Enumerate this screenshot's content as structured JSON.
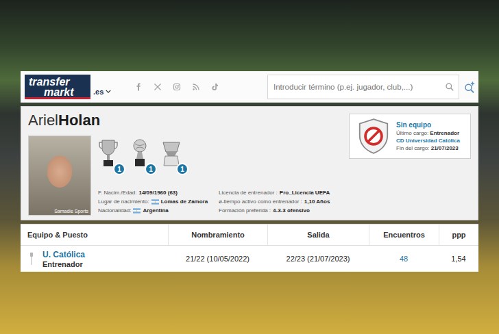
{
  "header": {
    "logo_line1": "transfer",
    "logo_line2": "markt",
    "domain": ".es",
    "search_placeholder": "Introducir término (p.ej. jugador, club,...)"
  },
  "profile": {
    "first_name": "Ariel",
    "last_name": "Holan",
    "photo_credit": "Samadie Sports",
    "trophies": [
      {
        "kind": "cup",
        "count": "1"
      },
      {
        "kind": "ball",
        "count": "1"
      },
      {
        "kind": "bowl",
        "count": "1"
      }
    ],
    "facts_left": [
      {
        "label": "F. Nacim./Edad:",
        "value": "14/09/1960 (63)",
        "flag": false
      },
      {
        "label": "Lugar de nacimiento:",
        "value": "Lomas de Zamora",
        "flag": true
      },
      {
        "label": "Nacionalidad:",
        "value": "Argentina",
        "flag": true
      }
    ],
    "facts_right": [
      {
        "label": "Licencia de entrenador :",
        "value": "Pro_Licencia UEFA",
        "flag": false
      },
      {
        "label": "ø-tiempo activo como entrenador :",
        "value": "1,10 Años",
        "flag": false
      },
      {
        "label": "Formación preferida :",
        "value": "4-3-3 ofensivo",
        "flag": false
      }
    ]
  },
  "status": {
    "title": "Sin equipo",
    "last_role_label": "Último cargo:",
    "last_role": "Entrenador",
    "club": "CD Universidad Católica",
    "end_label": "Fin del cargo:",
    "end": "21/07/2023"
  },
  "table": {
    "columns": [
      "Equipo & Puesto",
      "Nombramiento",
      "Salida",
      "Encuentros",
      "ppp"
    ],
    "rows": [
      {
        "team": "U. Católica",
        "role": "Entrenador",
        "appointed": "21/22 (10/05/2022)",
        "left": "22/23 (21/07/2023)",
        "matches": "48",
        "ppp": "1,54"
      }
    ]
  }
}
